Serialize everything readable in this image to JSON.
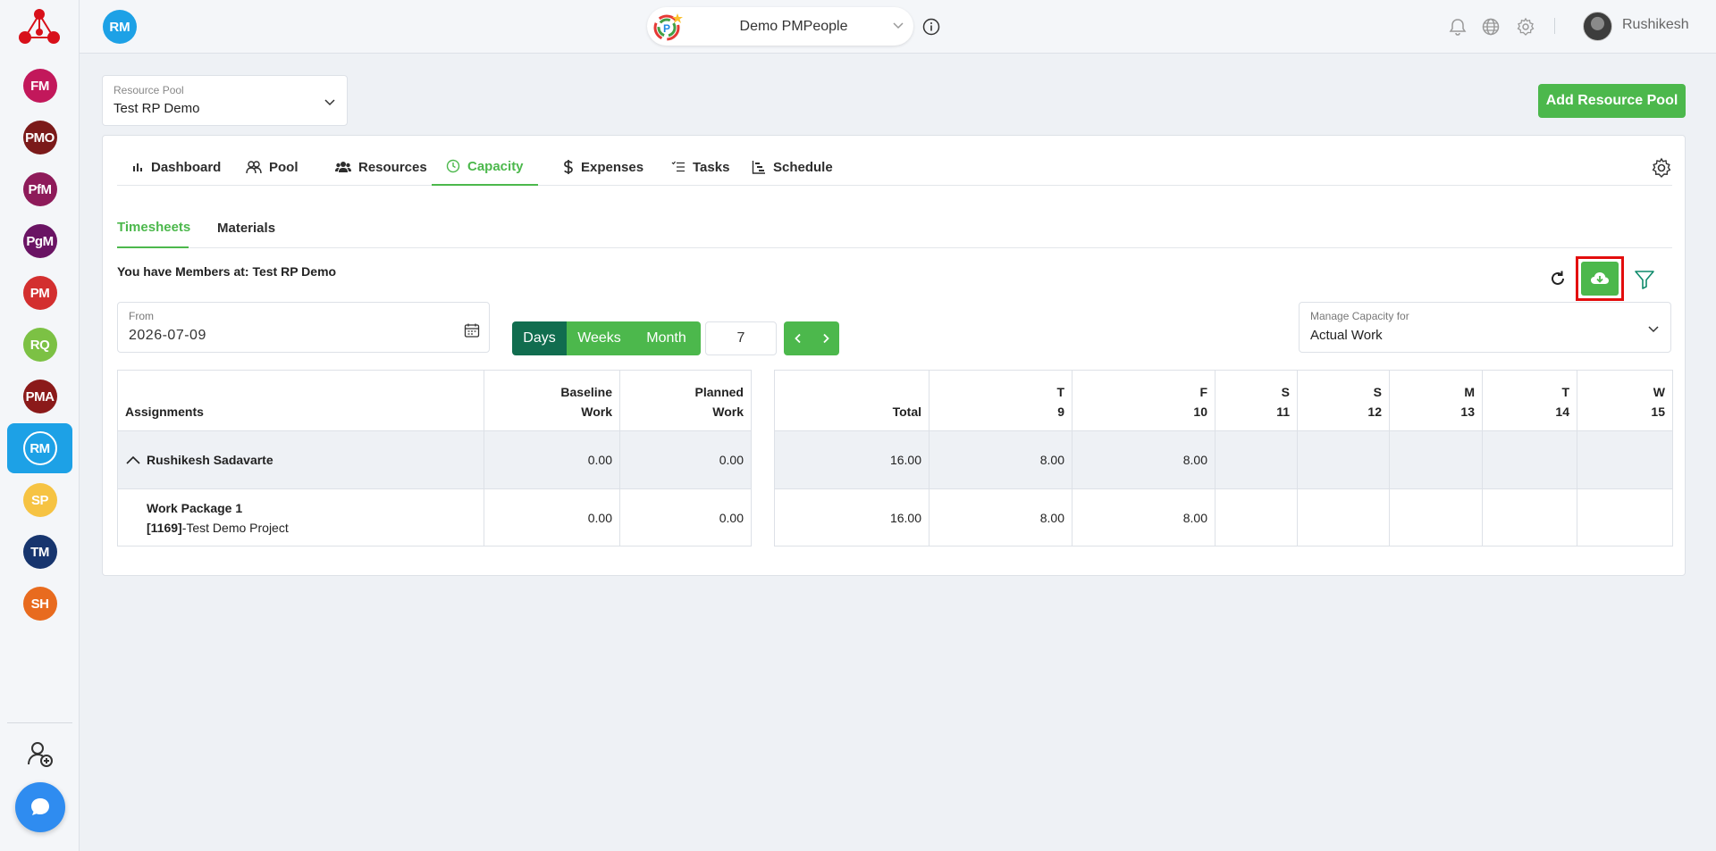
{
  "topbar": {
    "workspace_avatar": "RM",
    "org_name": "Demo PMPeople",
    "user_name": "Rushikesh"
  },
  "rail": {
    "items": [
      {
        "label": "FM",
        "color": "#c2185b",
        "active": false
      },
      {
        "label": "PMO",
        "color": "#7b1a1a",
        "active": false
      },
      {
        "label": "PfM",
        "color": "#8e1b5a",
        "active": false
      },
      {
        "label": "PgM",
        "color": "#6a1464",
        "active": false
      },
      {
        "label": "PM",
        "color": "#d32f2f",
        "active": false
      },
      {
        "label": "RQ",
        "color": "#7cc144",
        "active": false
      },
      {
        "label": "PMA",
        "color": "#8b1a1a",
        "active": false
      },
      {
        "label": "RM",
        "color": "#1da1e6",
        "active": true
      },
      {
        "label": "SP",
        "color": "#f6c343",
        "active": false
      },
      {
        "label": "TM",
        "color": "#17356e",
        "active": false
      },
      {
        "label": "SH",
        "color": "#e86b1f",
        "active": false
      }
    ]
  },
  "resource_pool": {
    "label": "Resource Pool",
    "value": "Test RP Demo"
  },
  "add_pool_label": "Add Resource Pool",
  "tabs": [
    {
      "label": "Dashboard",
      "icon": "bar-chart-icon",
      "active": false
    },
    {
      "label": "Pool",
      "icon": "people-icon",
      "active": false
    },
    {
      "label": "Resources",
      "icon": "group-icon",
      "active": false
    },
    {
      "label": "Capacity",
      "icon": "clock-icon",
      "active": true
    },
    {
      "label": "Expenses",
      "icon": "dollar-icon",
      "active": false
    },
    {
      "label": "Tasks",
      "icon": "list-icon",
      "active": false
    },
    {
      "label": "Schedule",
      "icon": "gantt-icon",
      "active": false
    }
  ],
  "subtabs": [
    {
      "label": "Timesheets",
      "active": true
    },
    {
      "label": "Materials",
      "active": false
    }
  ],
  "members_text": "You have Members at: Test RP Demo",
  "from": {
    "label": "From",
    "value": "2026-07-09"
  },
  "period": {
    "options": [
      "Days",
      "Weeks",
      "Month"
    ],
    "selected": "Days",
    "count": "7"
  },
  "manage_capacity": {
    "label": "Manage Capacity for",
    "value": "Actual Work"
  },
  "left_table": {
    "headers": {
      "assignments": "Assignments",
      "baseline_1": "Baseline",
      "baseline_2": "Work",
      "planned_1": "Planned",
      "planned_2": "Work"
    },
    "group": {
      "name": "Rushikesh Sadavarte",
      "baseline": "0.00",
      "planned": "0.00"
    },
    "item": {
      "title": "Work Package 1",
      "code": "[1169]",
      "project": "-Test Demo Project",
      "baseline": "0.00",
      "planned": "0.00"
    }
  },
  "right_table": {
    "total_label": "Total",
    "days": [
      {
        "dow": "T",
        "day": "9"
      },
      {
        "dow": "F",
        "day": "10"
      },
      {
        "dow": "S",
        "day": "11"
      },
      {
        "dow": "S",
        "day": "12"
      },
      {
        "dow": "M",
        "day": "13"
      },
      {
        "dow": "T",
        "day": "14"
      },
      {
        "dow": "W",
        "day": "15"
      }
    ],
    "group_row": {
      "total": "16.00",
      "values": [
        "8.00",
        "8.00",
        "",
        "",
        "",
        "",
        ""
      ]
    },
    "item_row": {
      "total": "16.00",
      "values": [
        "8.00",
        "8.00",
        "",
        "",
        "",
        "",
        ""
      ]
    }
  }
}
